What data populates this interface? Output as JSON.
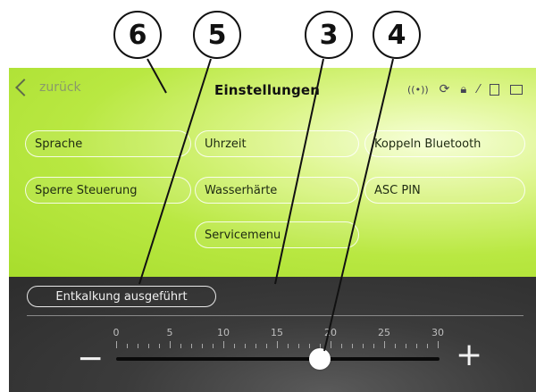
{
  "callouts": [
    "6",
    "5",
    "3",
    "4"
  ],
  "header": {
    "back_label": "zurück",
    "title": "Einstellungen",
    "status_icons": [
      "wireless-icon",
      "sync-icon",
      "lock-icon",
      "wrench-icon",
      "device-icon",
      "battery-icon"
    ]
  },
  "menu": {
    "sprache": "Sprache",
    "uhrzeit": "Uhrzeit",
    "koppeln": "Koppeln Bluetooth",
    "sperre": "Sperre Steuerung",
    "wasserhaerte": "Wasserhärte",
    "asc_pin": "ASC PIN",
    "servicemenu": "Servicemenu"
  },
  "status": {
    "label": "Entkalkung ausgeführt"
  },
  "slider": {
    "scale_labels": [
      "0",
      "5",
      "10",
      "15",
      "20",
      "25",
      "30"
    ],
    "min": 0,
    "max": 30,
    "value": 19,
    "minus_label": "−",
    "plus_label": "+"
  }
}
